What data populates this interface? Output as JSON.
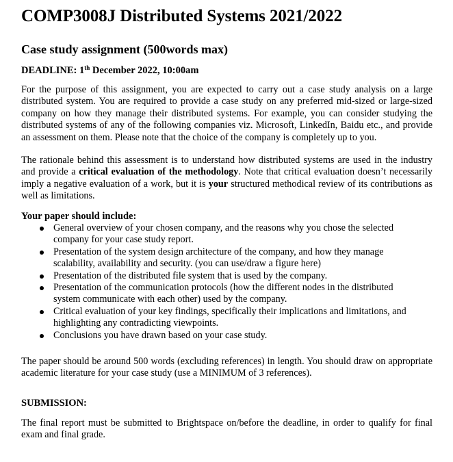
{
  "document": {
    "title": "COMP3008J Distributed Systems 2021/2022",
    "subtitle": "Case study assignment (500words max)",
    "deadline": {
      "label": "DEADLINE: 1",
      "suffix": "th",
      "rest": " December 2022, 10:00am"
    },
    "paragraph1": "For the purpose of this assignment, you are expected to carry out a case study analysis on a large distributed system. You are required to provide a case study on any preferred mid-sized or large-sized company on how they manage their distributed systems. For example, you can consider studying the distributed systems of any of the following companies viz. Microsoft, LinkedIn, Baidu etc., and provide an assessment on them. Please note that the choice of the company is completely up to you.",
    "paragraph2": {
      "part1": "The rationale behind this assessment is to understand how distributed systems are used in the industry and provide a ",
      "bold1": "critical evaluation of the methodology",
      "part2": ". Note that critical evaluation doesn’t necessarily imply a negative evaluation of a work, but it is ",
      "bold2": "your",
      "part3": " structured methodical review of its contributions as well as limitations."
    },
    "include_heading": "Your paper should include:",
    "include_items": [
      "General overview of your chosen company, and the reasons why you chose the selected company for your case study report.",
      "Presentation of the system design architecture of the company, and how they manage scalability, availability and security. (you can use/draw a figure here)",
      "Presentation of the distributed file system that is used by the company.",
      "Presentation of the communication protocols (how the different nodes in the distributed system communicate with each other) used by the company.",
      "Critical evaluation of your key findings, specifically their implications and limitations, and highlighting any contradicting viewpoints.",
      "Conclusions you have drawn based on your case study."
    ],
    "paragraph3": "The paper should be around 500 words (excluding references) in length. You should draw on appropriate academic literature for your case study (use a MINIMUM of 3 references).",
    "submission_heading": "SUBMISSION:",
    "paragraph4": "The final report must be submitted to Brightspace on/before the deadline, in order to qualify for final exam and final grade."
  }
}
